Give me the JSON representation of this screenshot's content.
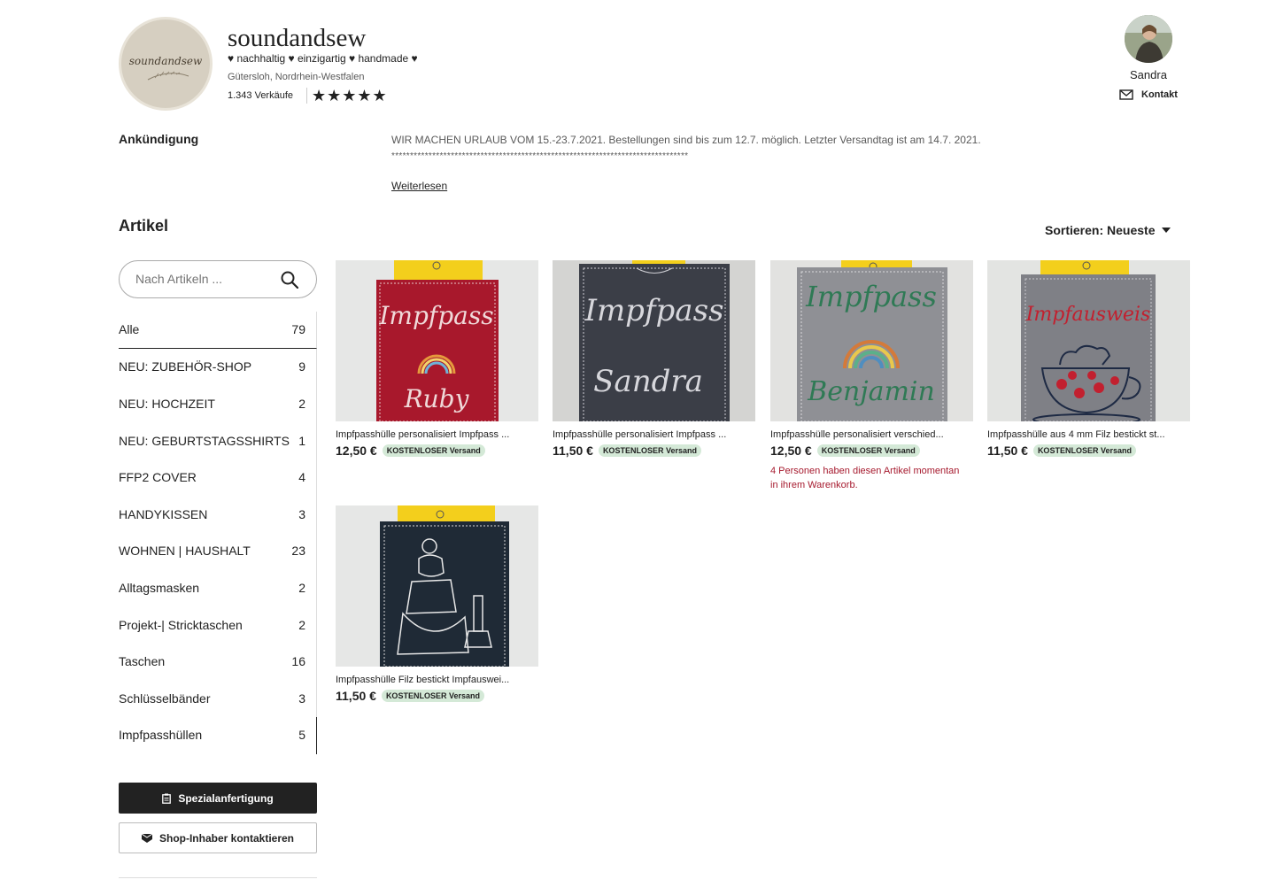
{
  "shop": {
    "logo_text": "soundandsew",
    "name": "soundandsew",
    "tagline": "♥ nachhaltig ♥ einzigartig ♥ handmade ♥",
    "location": "Gütersloh, Nordrhein-Westfalen",
    "sales": "1.343 Verkäufe",
    "rating": "★★★★★",
    "rating_value": 5,
    "owner_name": "Sandra",
    "contact_label": "Kontakt"
  },
  "announcement": {
    "label": "Ankündigung",
    "text": "WIR MACHEN URLAUB VOM 15.-23.7.2021. Bestellungen sind bis zum 12.7. möglich. Letzter Versandtag ist am 14.7. 2021.",
    "divider": "********************************************************************************",
    "read_more": "Weiterlesen"
  },
  "items_section": {
    "title": "Artikel",
    "sort_label": "Sortieren: Neueste"
  },
  "search": {
    "placeholder": "Nach Artikeln ..."
  },
  "categories": [
    {
      "label": "Alle",
      "count": "79"
    },
    {
      "label": "NEU: ZUBEHÖR-SHOP",
      "count": "9"
    },
    {
      "label": "NEU: HOCHZEIT",
      "count": "2"
    },
    {
      "label": "NEU: GEBURTSTAGSSHIRTS",
      "count": "1"
    },
    {
      "label": "FFP2 COVER",
      "count": "4"
    },
    {
      "label": "HANDYKISSEN",
      "count": "3"
    },
    {
      "label": "WOHNEN | HAUSHALT",
      "count": "23"
    },
    {
      "label": "Alltagsmasken",
      "count": "2"
    },
    {
      "label": "Projekt-| Stricktaschen",
      "count": "2"
    },
    {
      "label": "Taschen",
      "count": "16"
    },
    {
      "label": "Schlüsselbänder",
      "count": "3"
    },
    {
      "label": "Impfpasshüllen",
      "count": "5"
    }
  ],
  "buttons": {
    "special": "Spezialanfertigung",
    "contact_owner": "Shop-Inhaber kontaktieren"
  },
  "products": [
    {
      "title": "Impfpasshülle personalisiert Impfpass ...",
      "price": "12,50 €",
      "badge": "KOSTENLOSER Versand",
      "image_text_1": "Impfpass",
      "image_text_2": "Ruby",
      "felt_color": "#a8182c",
      "thread_color": "#f0d9d9"
    },
    {
      "title": "Impfpasshülle personalisiert Impfpass ...",
      "price": "11,50 €",
      "badge": "KOSTENLOSER Versand",
      "image_text_1": "Impfpass",
      "image_text_2": "Sandra",
      "felt_color": "#3b3e47",
      "thread_color": "#d7d7dc"
    },
    {
      "title": "Impfpasshülle personalisiert verschied...",
      "price": "12,50 €",
      "badge": "KOSTENLOSER Versand",
      "image_text_1": "Impfpass",
      "image_text_2": "Benjamin",
      "felt_color": "#8f9095",
      "thread_color": "#2f7a55",
      "note": "4 Personen haben diesen Artikel momentan in ihrem Warenkorb."
    },
    {
      "title": "Impfpasshülle aus 4 mm Filz bestickt st...",
      "price": "11,50 €",
      "badge": "KOSTENLOSER Versand",
      "image_text_1": "Impfausweis",
      "image_text_2": "",
      "felt_color": "#7f8086",
      "thread_color": "#c2202f"
    },
    {
      "title": "Impfpasshülle Filz bestickt Impfauswei...",
      "price": "11,50 €",
      "badge": "KOSTENLOSER Versand",
      "image_text_1": "",
      "image_text_2": "",
      "felt_color": "#1f2a36",
      "thread_color": "#e8e8e8"
    }
  ]
}
